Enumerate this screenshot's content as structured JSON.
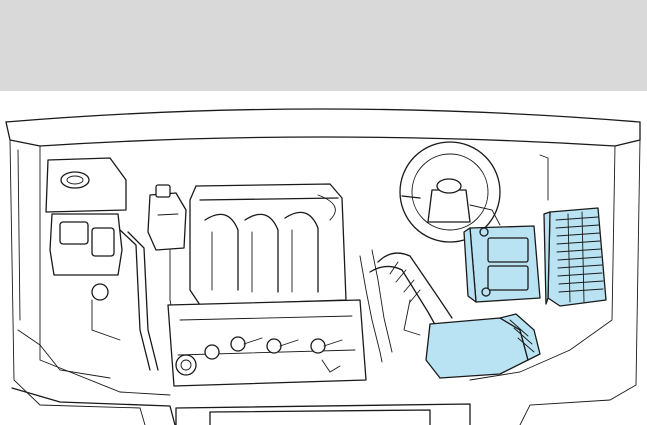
{
  "banner": {
    "color": "#d9d9d9"
  },
  "highlight_color": "#b9e3f2",
  "components": [
    "battery-box-icon",
    "fuse-box-icon",
    "air-filter-housing-icon"
  ]
}
